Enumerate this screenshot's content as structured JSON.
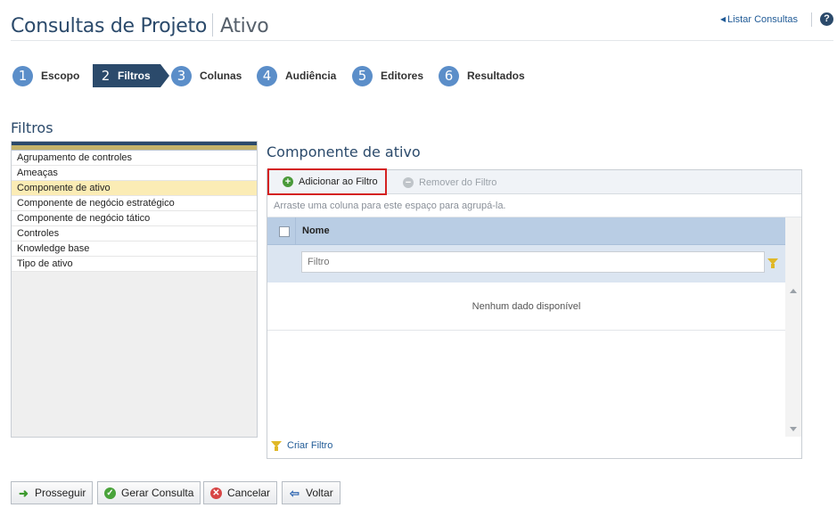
{
  "header": {
    "title": "Consultas de Projeto",
    "subtitle": "Ativo",
    "list_link": "Listar Consultas",
    "help": "?"
  },
  "steps": [
    {
      "num": "1",
      "label": "Escopo"
    },
    {
      "num": "2",
      "label": "Filtros"
    },
    {
      "num": "3",
      "label": "Colunas"
    },
    {
      "num": "4",
      "label": "Audiência"
    },
    {
      "num": "5",
      "label": "Editores"
    },
    {
      "num": "6",
      "label": "Resultados"
    }
  ],
  "active_step": "2",
  "section_title": "Filtros",
  "left_list": {
    "items": [
      "Agrupamento de controles",
      "Ameaças",
      "Componente de ativo",
      "Componente de negócio estratégico",
      "Componente de negócio tático",
      "Controles",
      "Knowledge base",
      "Tipo de ativo"
    ],
    "selected": "Componente de ativo"
  },
  "panel": {
    "title": "Componente de ativo",
    "add_filter": "Adicionar ao Filtro",
    "remove_filter": "Remover do Filtro",
    "group_hint": "Arraste uma coluna para este espaço para agrupá-la.",
    "column_name": "Nome",
    "filter_placeholder": "Filtro",
    "no_data": "Nenhum dado disponível",
    "create_filter": "Criar Filtro"
  },
  "buttons": {
    "proceed": "Prosseguir",
    "generate": "Gerar Consulta",
    "cancel": "Cancelar",
    "back": "Voltar"
  },
  "colors": {
    "primary": "#2b4a6b",
    "step_circle": "#5b8ec9",
    "selected_row": "#fbecb5",
    "highlight_border": "#d42222"
  }
}
